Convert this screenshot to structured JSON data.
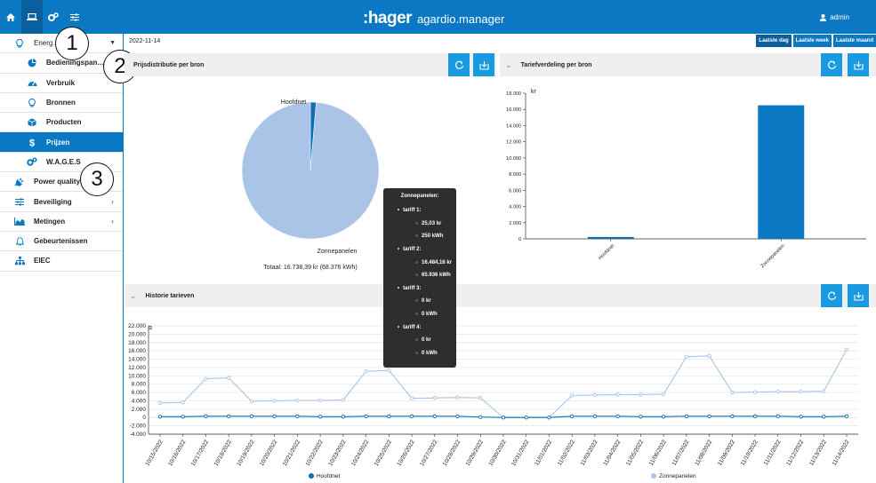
{
  "header": {
    "brand_main": ":hager",
    "brand_sub": "agardio.manager",
    "user": "admin",
    "icons": [
      "home-icon",
      "laptop-icon",
      "gears-icon",
      "sliders-icon"
    ]
  },
  "sidebar": {
    "items": [
      {
        "label": "Energ…      n…",
        "icon": "bulb-icon",
        "level": "top"
      },
      {
        "label": "Bedieningspan…",
        "icon": "pie-icon",
        "level": "sub"
      },
      {
        "label": "Verbruik",
        "icon": "gauge-icon",
        "level": "sub"
      },
      {
        "label": "Bronnen",
        "icon": "bulb-icon",
        "level": "sub"
      },
      {
        "label": "Producten",
        "icon": "box-icon",
        "level": "sub"
      },
      {
        "label": "Prijzen",
        "icon": "dollar-icon",
        "level": "sub",
        "active": true
      },
      {
        "label": "W.A.G.E.S",
        "icon": "gears-icon",
        "level": "sub"
      },
      {
        "label": "Power quality",
        "icon": "plug-icon",
        "level": "top",
        "chevron": true
      },
      {
        "label": "Beveiliging",
        "icon": "sliders-icon",
        "level": "top",
        "chevron": true
      },
      {
        "label": "Metingen",
        "icon": "area-chart-icon",
        "level": "top",
        "chevron": true
      },
      {
        "label": "Gebeurtenissen",
        "icon": "bell-icon",
        "level": "top"
      },
      {
        "label": "EIEC",
        "icon": "sitemap-icon",
        "level": "top"
      }
    ],
    "callouts": [
      "1",
      "2",
      "3"
    ]
  },
  "toolbar": {
    "date": "2022-11-14",
    "periods": [
      "Laatste dag",
      "Laatste week",
      "Laatste maand"
    ]
  },
  "panels": {
    "pie_title": "Prijsdistributie per bron",
    "bar_title": "Tariefverdeling per bron",
    "line_title": "Historie tarieven",
    "pie_total": "Totaal: 16.738,39 kr (68.376 kWh)"
  },
  "tooltip": {
    "title": "Zonnepanelen:",
    "lines": [
      {
        "level": 1,
        "text": "tariff 1:"
      },
      {
        "level": 2,
        "text": "25,03 kr"
      },
      {
        "level": 2,
        "text": "250 kWh"
      },
      {
        "level": 1,
        "text": "tariff 2:"
      },
      {
        "level": 2,
        "text": "16.484,16 kr"
      },
      {
        "level": 2,
        "text": "65.936 kWh"
      },
      {
        "level": 1,
        "text": "tariff 3:"
      },
      {
        "level": 2,
        "text": "0 kr"
      },
      {
        "level": 2,
        "text": "0 kWh"
      },
      {
        "level": 1,
        "text": "tariff 4:"
      },
      {
        "level": 2,
        "text": "0 kr"
      },
      {
        "level": 2,
        "text": "0 kWh"
      }
    ]
  },
  "colors": {
    "primary": "#0a78c2",
    "button": "#1a9ae0",
    "hoofdnet": "#0b6fb0",
    "zonnepanelen": "#a9c4e6"
  },
  "chart_data": [
    {
      "type": "pie",
      "categories": [
        "Hoofdnet",
        "Zonnepanelen"
      ],
      "values": [
        229.2,
        16509.19
      ],
      "title": "",
      "colors": [
        "#0b6fb0",
        "#a9c4e6"
      ]
    },
    {
      "type": "bar",
      "categories": [
        "Hoofdnet",
        "Zonnepanelen"
      ],
      "values": [
        229.2,
        16509.19
      ],
      "ylabel": "kr",
      "ylim": [
        0,
        18000
      ],
      "yticks": [
        "0",
        "2.000",
        "4.000",
        "6.000",
        "8.000",
        "10.000",
        "12.000",
        "14.000",
        "16.000",
        "18.000"
      ],
      "colors": [
        "#0b6fb0",
        "#0a78c2"
      ]
    },
    {
      "type": "line",
      "x": [
        "10/15/2022",
        "10/16/2022",
        "10/17/2022",
        "10/18/2022",
        "10/19/2022",
        "10/20/2022",
        "10/21/2022",
        "10/22/2022",
        "10/23/2022",
        "10/24/2022",
        "10/25/2022",
        "10/26/2022",
        "10/27/2022",
        "10/28/2022",
        "10/29/2022",
        "10/30/2022",
        "10/31/2022",
        "11/01/2022",
        "11/02/2022",
        "11/03/2022",
        "11/04/2022",
        "11/05/2022",
        "11/06/2022",
        "11/07/2022",
        "11/08/2022",
        "11/09/2022",
        "11/10/2022",
        "11/11/2022",
        "11/12/2022",
        "11/13/2022",
        "11/14/2022"
      ],
      "ylabel": "kr",
      "ylim": [
        -4000,
        22000
      ],
      "yticks": [
        "-4.000",
        "-2.000",
        "0",
        "2.000",
        "4.000",
        "6.000",
        "8.000",
        "10.000",
        "12.000",
        "14.000",
        "16.000",
        "18.000",
        "20.000",
        "22.000"
      ],
      "grid": true,
      "legend": "bottom",
      "series": [
        {
          "name": "Hoofdnet",
          "color": "#0b6fb0",
          "values": [
            200,
            200,
            300,
            300,
            300,
            300,
            300,
            200,
            200,
            300,
            300,
            300,
            300,
            300,
            100,
            0,
            0,
            0,
            300,
            300,
            300,
            200,
            200,
            300,
            300,
            300,
            300,
            300,
            200,
            200,
            300
          ]
        },
        {
          "name": "Zonnepanelen",
          "color": "#a9c4e6",
          "values": [
            3500,
            3600,
            9300,
            9500,
            3900,
            4000,
            4100,
            4100,
            4200,
            11100,
            11300,
            4600,
            4700,
            4800,
            4700,
            0,
            0,
            0,
            5300,
            5400,
            5500,
            5500,
            5600,
            14600,
            14800,
            6000,
            6100,
            6200,
            6200,
            6300,
            16300
          ]
        }
      ]
    }
  ]
}
